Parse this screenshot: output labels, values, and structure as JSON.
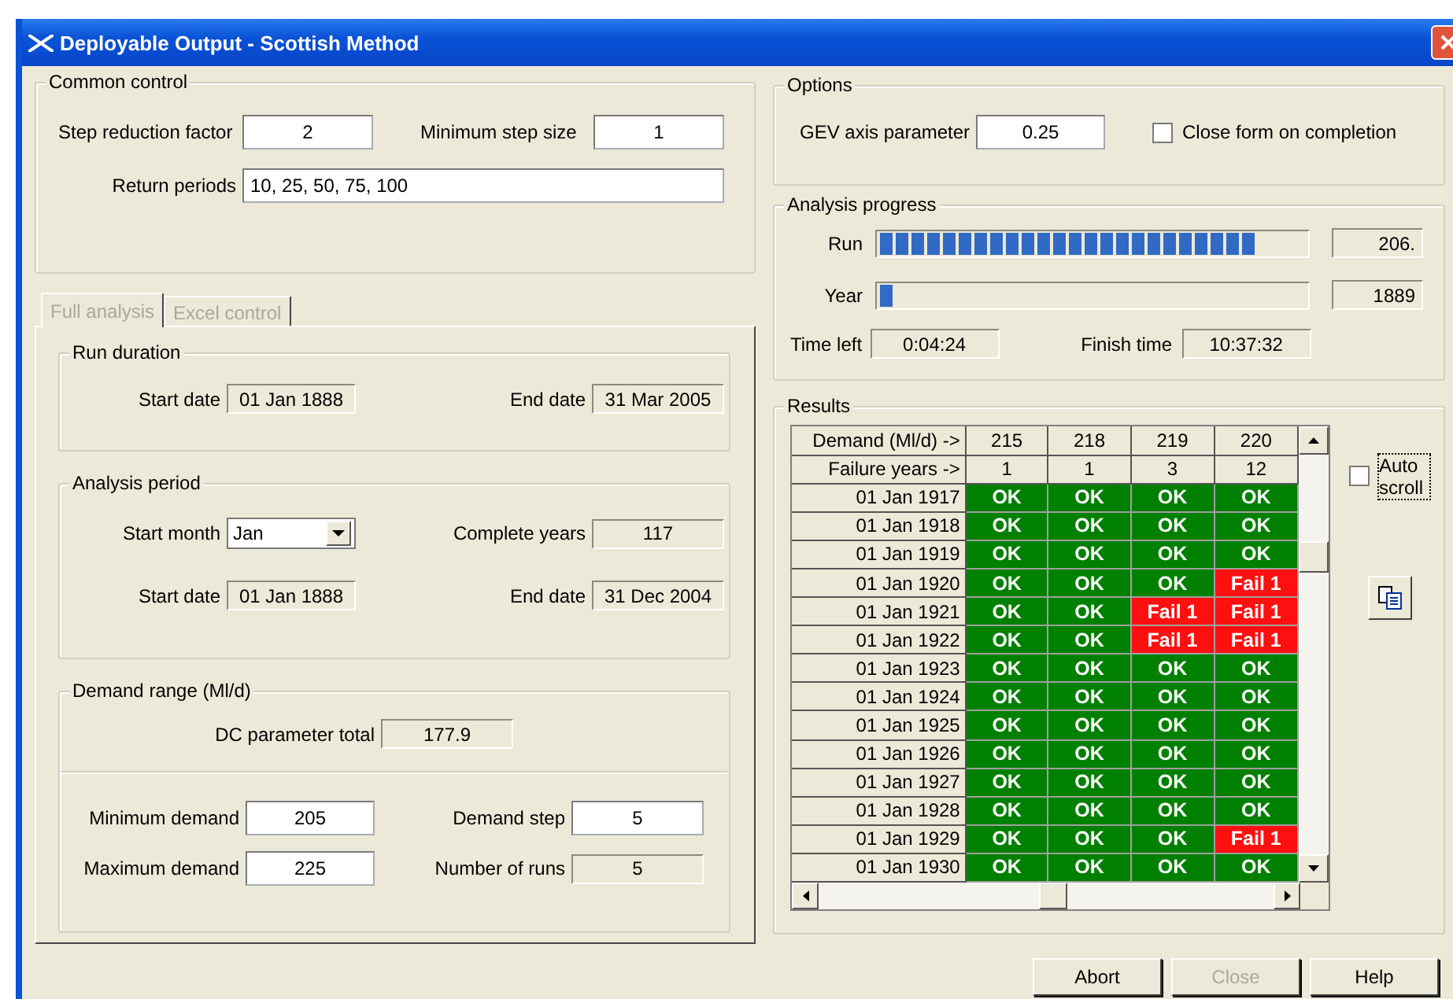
{
  "window": {
    "title": "Deployable Output - Scottish Method"
  },
  "common_control": {
    "title": "Common control",
    "step_reduction_factor": {
      "label": "Step reduction factor",
      "value": "2",
      "kind": "input"
    },
    "minimum_step_size": {
      "label": "Minimum step size",
      "value": "1",
      "kind": "input"
    },
    "return_periods": {
      "label": "Return periods",
      "value": "10, 25, 50, 75, 100",
      "kind": "input"
    }
  },
  "tabs": [
    {
      "label": "Full analysis",
      "selected": true,
      "disabled": true
    },
    {
      "label": "Excel control",
      "selected": false,
      "disabled": true
    }
  ],
  "run_duration": {
    "title": "Run duration",
    "start_date": {
      "label": "Start date",
      "value": "01 Jan 1888",
      "kind": "readonly"
    },
    "end_date": {
      "label": "End date",
      "value": "31 Mar 2005",
      "kind": "readonly"
    }
  },
  "analysis_period": {
    "title": "Analysis period",
    "start_month": {
      "label": "Start month",
      "value": "Jan",
      "kind": "select"
    },
    "complete_years": {
      "label": "Complete years",
      "value": "117",
      "kind": "readonly"
    },
    "start_date": {
      "label": "Start date",
      "value": "01 Jan 1888",
      "kind": "readonly"
    },
    "end_date": {
      "label": "End date",
      "value": "31 Dec 2004",
      "kind": "readonly"
    }
  },
  "demand_range": {
    "title": "Demand range (Ml/d)",
    "dc_parameter_total": {
      "label": "DC parameter total",
      "value": "177.9",
      "kind": "readonly"
    },
    "minimum_demand": {
      "label": "Minimum demand",
      "value": "205",
      "kind": "input"
    },
    "demand_step": {
      "label": "Demand step",
      "value": "5",
      "kind": "input"
    },
    "maximum_demand": {
      "label": "Maximum demand",
      "value": "225",
      "kind": "input"
    },
    "number_of_runs": {
      "label": "Number of runs",
      "value": "5",
      "kind": "readonly"
    }
  },
  "options": {
    "title": "Options",
    "gev_axis_parameter": {
      "label": "GEV axis parameter",
      "value": "0.25",
      "kind": "input"
    },
    "close_form_on_completion": {
      "label": "Close form on completion",
      "checked": false
    }
  },
  "analysis_progress": {
    "title": "Analysis progress",
    "run": {
      "label": "Run",
      "level": 0.89,
      "reading": "206."
    },
    "year": {
      "label": "Year",
      "level": 0.03,
      "reading": "1889"
    },
    "time_left": {
      "label": "Time left",
      "value": "0:04:24",
      "kind": "readonly"
    },
    "finish_time": {
      "label": "Finish time",
      "value": "10:37:32",
      "kind": "readonly"
    }
  },
  "results": {
    "title": "Results",
    "header_rows": [
      {
        "label": "Demand (Ml/d) ->",
        "values": [
          "215",
          "218",
          "219",
          "220"
        ]
      },
      {
        "label": "Failure years ->",
        "values": [
          "1",
          "1",
          "3",
          "12"
        ]
      }
    ],
    "rows": [
      {
        "date": "01 Jan 1917",
        "cells": [
          {
            "text": "OK",
            "failed": false
          },
          {
            "text": "OK",
            "failed": false
          },
          {
            "text": "OK",
            "failed": false
          },
          {
            "text": "OK",
            "failed": false
          }
        ]
      },
      {
        "date": "01 Jan 1918",
        "cells": [
          {
            "text": "OK",
            "failed": false
          },
          {
            "text": "OK",
            "failed": false
          },
          {
            "text": "OK",
            "failed": false
          },
          {
            "text": "OK",
            "failed": false
          }
        ]
      },
      {
        "date": "01 Jan 1919",
        "cells": [
          {
            "text": "OK",
            "failed": false
          },
          {
            "text": "OK",
            "failed": false
          },
          {
            "text": "OK",
            "failed": false
          },
          {
            "text": "OK",
            "failed": false
          }
        ]
      },
      {
        "date": "01 Jan 1920",
        "cells": [
          {
            "text": "OK",
            "failed": false
          },
          {
            "text": "OK",
            "failed": false
          },
          {
            "text": "OK",
            "failed": false
          },
          {
            "text": "Fail 1",
            "failed": true
          }
        ]
      },
      {
        "date": "01 Jan 1921",
        "cells": [
          {
            "text": "OK",
            "failed": false
          },
          {
            "text": "OK",
            "failed": false
          },
          {
            "text": "Fail 1",
            "failed": true
          },
          {
            "text": "Fail 1",
            "failed": true
          }
        ]
      },
      {
        "date": "01 Jan 1922",
        "cells": [
          {
            "text": "OK",
            "failed": false
          },
          {
            "text": "OK",
            "failed": false
          },
          {
            "text": "Fail 1",
            "failed": true
          },
          {
            "text": "Fail 1",
            "failed": true
          }
        ]
      },
      {
        "date": "01 Jan 1923",
        "cells": [
          {
            "text": "OK",
            "failed": false
          },
          {
            "text": "OK",
            "failed": false
          },
          {
            "text": "OK",
            "failed": false
          },
          {
            "text": "OK",
            "failed": false
          }
        ]
      },
      {
        "date": "01 Jan 1924",
        "cells": [
          {
            "text": "OK",
            "failed": false
          },
          {
            "text": "OK",
            "failed": false
          },
          {
            "text": "OK",
            "failed": false
          },
          {
            "text": "OK",
            "failed": false
          }
        ]
      },
      {
        "date": "01 Jan 1925",
        "cells": [
          {
            "text": "OK",
            "failed": false
          },
          {
            "text": "OK",
            "failed": false
          },
          {
            "text": "OK",
            "failed": false
          },
          {
            "text": "OK",
            "failed": false
          }
        ]
      },
      {
        "date": "01 Jan 1926",
        "cells": [
          {
            "text": "OK",
            "failed": false
          },
          {
            "text": "OK",
            "failed": false
          },
          {
            "text": "OK",
            "failed": false
          },
          {
            "text": "OK",
            "failed": false
          }
        ]
      },
      {
        "date": "01 Jan 1927",
        "cells": [
          {
            "text": "OK",
            "failed": false
          },
          {
            "text": "OK",
            "failed": false
          },
          {
            "text": "OK",
            "failed": false
          },
          {
            "text": "OK",
            "failed": false
          }
        ]
      },
      {
        "date": "01 Jan 1928",
        "cells": [
          {
            "text": "OK",
            "failed": false
          },
          {
            "text": "OK",
            "failed": false
          },
          {
            "text": "OK",
            "failed": false
          },
          {
            "text": "OK",
            "failed": false
          }
        ]
      },
      {
        "date": "01 Jan 1929",
        "cells": [
          {
            "text": "OK",
            "failed": false
          },
          {
            "text": "OK",
            "failed": false
          },
          {
            "text": "OK",
            "failed": false
          },
          {
            "text": "Fail 1",
            "failed": true
          }
        ]
      },
      {
        "date": "01 Jan 1930",
        "cells": [
          {
            "text": "OK",
            "failed": false
          },
          {
            "text": "OK",
            "failed": false
          },
          {
            "text": "OK",
            "failed": false
          },
          {
            "text": "OK",
            "failed": false
          }
        ]
      }
    ],
    "auto_scroll": {
      "label": "Auto scroll",
      "checked": false
    }
  },
  "buttons": [
    {
      "label": "Abort",
      "disabled": false
    },
    {
      "label": "Close",
      "disabled": true
    },
    {
      "label": "Help",
      "disabled": false
    }
  ]
}
